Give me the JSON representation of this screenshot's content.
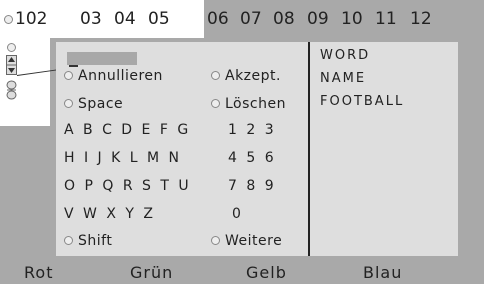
{
  "header": {
    "current_page": "102",
    "page_numbers": [
      "03",
      "04",
      "05",
      "06",
      "07",
      "08",
      "09",
      "10",
      "11",
      "12"
    ]
  },
  "keyboard": {
    "input_value": "",
    "actions": {
      "cancel": "Annullieren",
      "accept": "Akzept.",
      "space": "Space",
      "delete": "Löschen",
      "shift": "Shift",
      "more": "Weitere"
    },
    "rows": [
      {
        "letters": "A B C D E F G",
        "digits": "1 2 3"
      },
      {
        "letters": "H I J K L M N",
        "digits": "4 5 6"
      },
      {
        "letters": "O P Q R S T U",
        "digits": "7 8 9"
      },
      {
        "letters": "V W X Y Z",
        "digits": "0"
      }
    ]
  },
  "words": [
    "WORD",
    "NAME",
    "FOOTBALL"
  ],
  "color_keys": {
    "red": "Rot",
    "green": "Grün",
    "yellow": "Gelb",
    "blue": "Blau"
  }
}
